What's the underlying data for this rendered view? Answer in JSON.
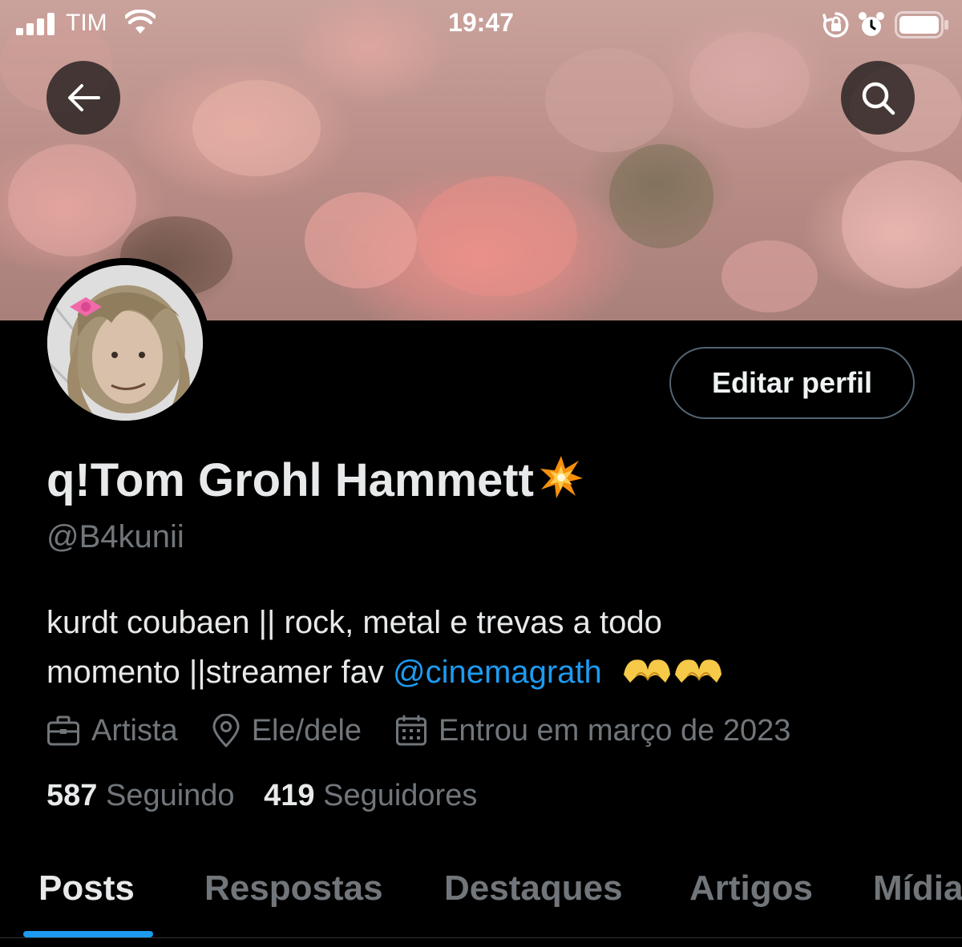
{
  "status_bar": {
    "carrier": "TIM",
    "time": "19:47"
  },
  "profile": {
    "display_name": "q!Tom Grohl Hammett",
    "handle": "@B4kunii",
    "edit_button_label": "Editar perfil",
    "bio": {
      "line1": "kurdt coubaen || rock, metal e trevas a todo",
      "line2_prefix": "momento ||streamer fav ",
      "mention": "@cinemagrath"
    },
    "meta": {
      "profession": "Artista",
      "location": "Ele/dele",
      "joined": "Entrou em março de 2023"
    },
    "following_count": "587",
    "following_label": "Seguindo",
    "followers_count": "419",
    "followers_label": "Seguidores"
  },
  "tabs": [
    {
      "label": "Posts",
      "active": true
    },
    {
      "label": "Respostas",
      "active": false
    },
    {
      "label": "Destaques",
      "active": false
    },
    {
      "label": "Artigos",
      "active": false
    },
    {
      "label": "Mídia",
      "active": false
    }
  ],
  "colors": {
    "accent": "#1d9bf0",
    "background": "#000000",
    "secondary_text": "#71767b"
  },
  "icons": [
    "back-arrow-icon",
    "search-icon",
    "briefcase-icon",
    "location-pin-icon",
    "calendar-icon",
    "collision-emoji",
    "heart-hands-emoji"
  ]
}
